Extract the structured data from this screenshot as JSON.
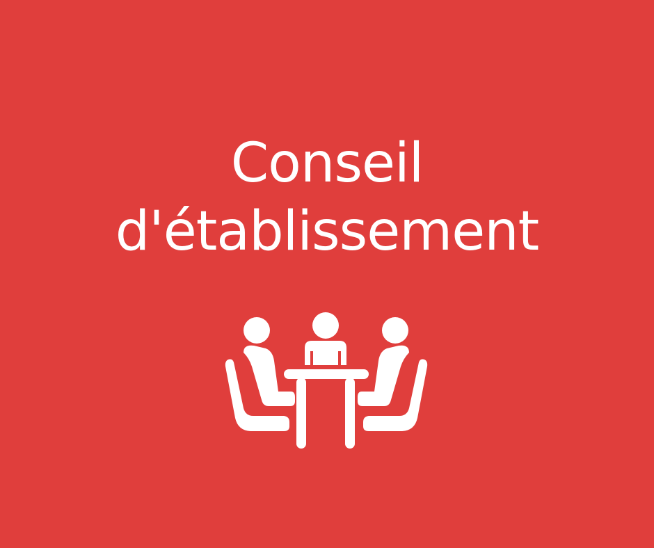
{
  "title": {
    "line1": "Conseil",
    "line2": "d'établissement"
  },
  "icon": {
    "name": "meeting-table-icon",
    "color": "#ffffff"
  },
  "colors": {
    "background": "#e03e3c",
    "foreground": "#ffffff"
  }
}
